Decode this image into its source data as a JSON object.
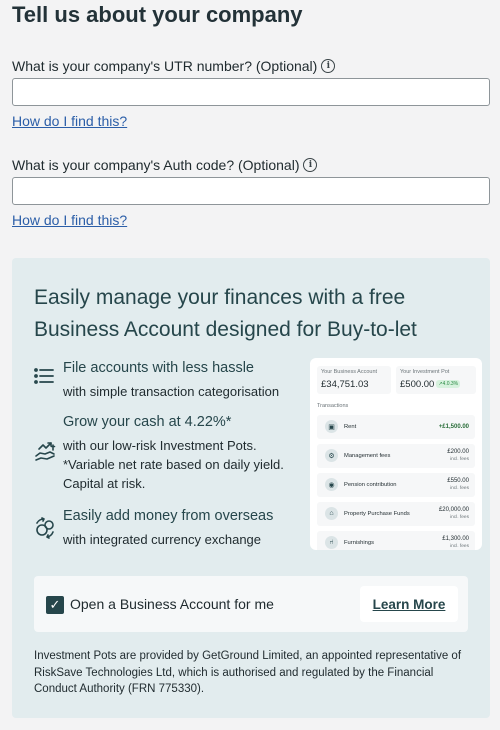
{
  "page": {
    "title": "Tell us about your company"
  },
  "utr": {
    "label": "What is your company's UTR number? (Optional)",
    "value": "",
    "placeholder": "",
    "help_link": "How do I find this?"
  },
  "auth": {
    "label": "What is your company's Auth code? (Optional)",
    "value": "",
    "placeholder": "",
    "help_link": "How do I find this?"
  },
  "promo": {
    "heading": "Easily manage your finances with a free Business Account designed for Buy-to-let",
    "features": [
      {
        "icon": "list-icon",
        "title": "File accounts with less hassle",
        "desc": "with simple transaction categorisation"
      },
      {
        "icon": "growth-hand-icon",
        "title": "Grow your cash at 4.22%*",
        "desc": "with our low-risk Investment Pots. *Variable net rate based on daily yield. Capital at risk."
      },
      {
        "icon": "currency-exchange-icon",
        "title": "Easily add money from overseas",
        "desc": "with integrated currency exchange"
      }
    ],
    "mockup": {
      "account_label": "Your Business Account",
      "account_value": "£34,751.03",
      "pot_label": "Your Investment Pot",
      "pot_value": "£500.00",
      "pot_badge": "↗4.0.3%",
      "transactions_label": "Transactions",
      "transactions": [
        {
          "name": "Rent",
          "amount": "+£1,500.00",
          "sub": "",
          "icon": "wallet-icon"
        },
        {
          "name": "Management fees",
          "amount": "£200.00",
          "sub": "incl. fees",
          "icon": "settings-icon"
        },
        {
          "name": "Pension contribution",
          "amount": "£550.00",
          "sub": "incl. fees",
          "icon": "piggy-bank-icon"
        },
        {
          "name": "Property Purchase Funds",
          "amount": "£20,000.00",
          "sub": "incl. fees",
          "icon": "house-icon"
        },
        {
          "name": "Furnishings",
          "amount": "£1,300.00",
          "sub": "incl. fees",
          "icon": "chair-icon"
        }
      ]
    },
    "opt_in": {
      "checked": true,
      "label": "Open a Business Account for me",
      "learn_more": "Learn More"
    },
    "disclaimer": "Investment Pots are provided by GetGround Limited, an appointed representative of RiskSave Technologies Ltd, which is authorised and regulated by the Financial Conduct Authority (FRN 775330)."
  },
  "colors": {
    "background": "#f3f3f4",
    "panel": "#e2ecee",
    "accent": "#26464b",
    "link": "#2b5ea8"
  }
}
